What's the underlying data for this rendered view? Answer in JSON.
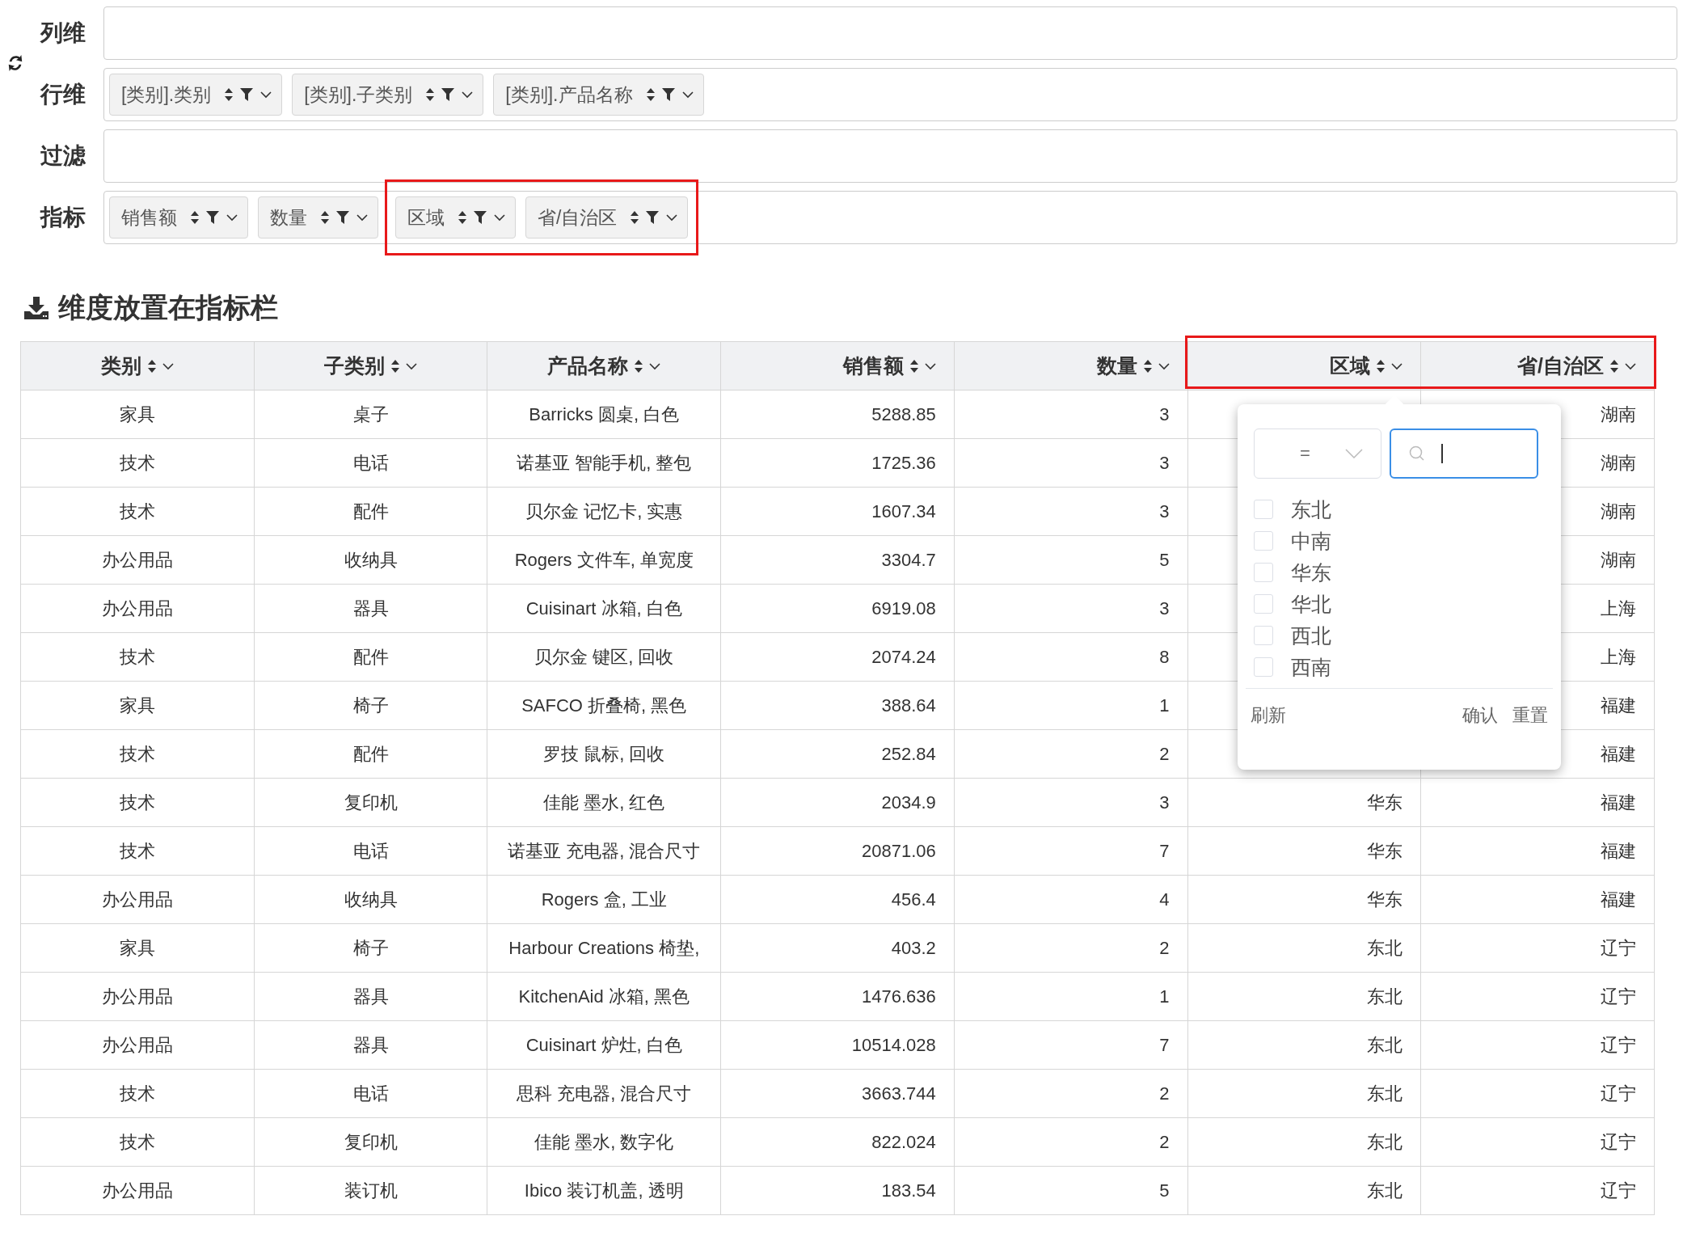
{
  "config": [
    {
      "label": "列维"
    },
    {
      "label": "行维",
      "chips": [
        {
          "label": "[类别].类别",
          "highlighted": false
        },
        {
          "label": "[类别].子类别",
          "highlighted": false
        },
        {
          "label": "[类别].产品名称",
          "highlighted": false
        }
      ]
    },
    {
      "label": "过滤"
    },
    {
      "label": "指标",
      "chips": [
        {
          "label": "销售额",
          "highlighted": false
        },
        {
          "label": "数量",
          "highlighted": false
        },
        {
          "label": "区域",
          "highlighted": true
        },
        {
          "label": "省/自治区",
          "highlighted": true
        }
      ]
    }
  ],
  "heading": "维度放置在指标栏",
  "table": {
    "columns": [
      {
        "label": "类别",
        "kind": "dimension",
        "highlighted": false
      },
      {
        "label": "子类别",
        "kind": "dimension",
        "highlighted": false
      },
      {
        "label": "产品名称",
        "kind": "dimension",
        "highlighted": false
      },
      {
        "label": "销售额",
        "kind": "indicator",
        "highlighted": false
      },
      {
        "label": "数量",
        "kind": "indicator",
        "highlighted": false
      },
      {
        "label": "区域",
        "kind": "indicator",
        "highlighted": true
      },
      {
        "label": "省/自治区",
        "kind": "indicator",
        "highlighted": true
      }
    ],
    "rows": [
      [
        "家具",
        "桌子",
        "Barricks 圆桌, 白色",
        "5288.85",
        "3",
        null,
        "湖南"
      ],
      [
        "技术",
        "电话",
        "诺基亚 智能手机, 整包",
        "1725.36",
        "3",
        null,
        "湖南"
      ],
      [
        "技术",
        "配件",
        "贝尔金 记忆卡, 实惠",
        "1607.34",
        "3",
        null,
        "湖南"
      ],
      [
        "办公用品",
        "收纳具",
        "Rogers 文件车, 单宽度",
        "3304.7",
        "5",
        null,
        "湖南"
      ],
      [
        "办公用品",
        "器具",
        "Cuisinart 冰箱, 白色",
        "6919.08",
        "3",
        null,
        "上海"
      ],
      [
        "技术",
        "配件",
        "贝尔金 键区, 回收",
        "2074.24",
        "8",
        null,
        "上海"
      ],
      [
        "家具",
        "椅子",
        "SAFCO 折叠椅, 黑色",
        "388.64",
        "1",
        null,
        "福建"
      ],
      [
        "技术",
        "配件",
        "罗技 鼠标, 回收",
        "252.84",
        "2",
        null,
        "福建"
      ],
      [
        "技术",
        "复印机",
        "佳能 墨水, 红色",
        "2034.9",
        "3",
        "华东",
        "福建"
      ],
      [
        "技术",
        "电话",
        "诺基亚 充电器, 混合尺寸",
        "20871.06",
        "7",
        "华东",
        "福建"
      ],
      [
        "办公用品",
        "收纳具",
        "Rogers 盒, 工业",
        "456.4",
        "4",
        "华东",
        "福建"
      ],
      [
        "家具",
        "椅子",
        "Harbour Creations 椅垫,",
        "403.2",
        "2",
        "东北",
        "辽宁"
      ],
      [
        "办公用品",
        "器具",
        "KitchenAid 冰箱, 黑色",
        "1476.636",
        "1",
        "东北",
        "辽宁"
      ],
      [
        "办公用品",
        "器具",
        "Cuisinart 炉灶, 白色",
        "10514.028",
        "7",
        "东北",
        "辽宁"
      ],
      [
        "技术",
        "电话",
        "思科 充电器, 混合尺寸",
        "3663.744",
        "2",
        "东北",
        "辽宁"
      ],
      [
        "技术",
        "复印机",
        "佳能 墨水, 数字化",
        "822.024",
        "2",
        "东北",
        "辽宁"
      ],
      [
        "办公用品",
        "装订机",
        "Ibico 装订机盖, 透明",
        "183.54",
        "5",
        "东北",
        "辽宁"
      ]
    ]
  },
  "filter_popup": {
    "operator": "=",
    "search": {
      "focused": true
    },
    "options": [
      {
        "label": "东北",
        "checked": false
      },
      {
        "label": "中南",
        "checked": false
      },
      {
        "label": "华东",
        "checked": false
      },
      {
        "label": "华北",
        "checked": false
      },
      {
        "label": "西北",
        "checked": false
      },
      {
        "label": "西南",
        "checked": false
      }
    ],
    "refresh": "刷新",
    "confirm": "确认",
    "reset": "重置"
  }
}
